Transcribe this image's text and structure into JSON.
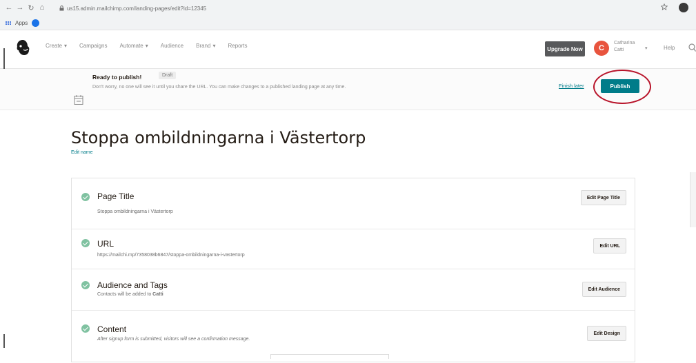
{
  "browser": {
    "back": "←",
    "forward": "→",
    "reload": "↻",
    "home": "⌂",
    "url": "us15.admin.mailchimp.com/landing-pages/edit?id=12345",
    "bookmarks_label": "Apps",
    "lock_icon": "lock-icon"
  },
  "nav": {
    "items": [
      {
        "label": "Create",
        "caret": true
      },
      {
        "label": "Campaigns",
        "caret": false
      },
      {
        "label": "Automate",
        "caret": true
      },
      {
        "label": "Audience",
        "caret": false
      },
      {
        "label": "Brand",
        "caret": true
      },
      {
        "label": "Reports",
        "caret": false
      }
    ],
    "upgrade": "Upgrade Now",
    "avatar_initial": "C",
    "user_name_line1": "Catharina",
    "user_name_line2": "Catti",
    "help": "Help",
    "caret": "▾"
  },
  "banner": {
    "title": "Ready to publish!",
    "badge": "Draft",
    "text": "Don't worry, no one will see it until you share the URL. You can make changes to a published landing page at any time.",
    "finish_later": "Finish later",
    "publish": "Publish"
  },
  "page": {
    "title": "Stoppa ombildningarna i Västertorp",
    "edit_name": "Edit name"
  },
  "sections": [
    {
      "title": "Page Title",
      "desc": "Stoppa ombildningarna i Västertorp",
      "button": "Edit Page Title"
    },
    {
      "title": "URL",
      "desc": "https://mailchi.mp/7358038b6847/stoppa-ombildningarna-i-vastertorp",
      "button": "Edit URL"
    },
    {
      "title": "Audience and Tags",
      "desc_prefix": "Contacts will be added to ",
      "desc_bold": "Catti",
      "button": "Edit Audience"
    },
    {
      "title": "Content",
      "desc": "After signup form is submitted, visitors will see a confirmation message.",
      "button": "Edit Design"
    }
  ],
  "colors": {
    "accent": "#007c89",
    "upgrade": "#58595b",
    "avatar": "#e8543e",
    "check": "#80c2a1",
    "annotation": "#b8142a"
  }
}
